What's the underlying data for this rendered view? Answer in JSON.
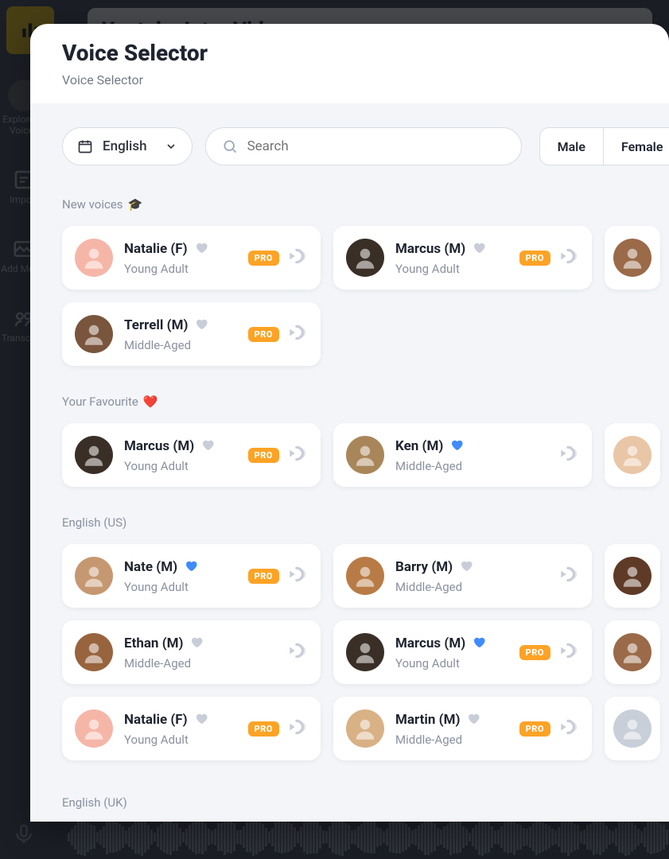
{
  "bg": {
    "project_title": "Youtube Intro Video",
    "sidebar": {
      "explore": "Explore AI Voices",
      "import": "Import",
      "media": "Add Media",
      "transcribe": "Transcribe"
    }
  },
  "modal": {
    "title": "Voice Selector",
    "subtitle": "Voice Selector",
    "language": "English",
    "search_placeholder": "Search",
    "segments": {
      "male": "Male",
      "female": "Female"
    },
    "pro_label": "PRO",
    "sections": [
      {
        "key": "new",
        "label": "New voices",
        "emoji": "🎓",
        "cards": [
          {
            "name": "Natalie (F)",
            "age": "Young Adult",
            "pro": true,
            "heart": "grey",
            "avatar": "#f5b6a8"
          },
          {
            "name": "Marcus (M)",
            "age": "Young Adult",
            "pro": true,
            "heart": "grey",
            "avatar": "#3a2f27"
          },
          {
            "name": "",
            "age": "",
            "pro": false,
            "heart": "",
            "avatar": "#9a6a49",
            "peek": true
          },
          {
            "name": "Terrell (M)",
            "age": "Middle-Aged",
            "pro": true,
            "heart": "grey",
            "avatar": "#7a553d"
          }
        ]
      },
      {
        "key": "fav",
        "label": "Your Favourite",
        "emoji": "❤️",
        "cards": [
          {
            "name": "Marcus (M)",
            "age": "Young Adult",
            "pro": true,
            "heart": "grey",
            "avatar": "#3a2f27"
          },
          {
            "name": "Ken (M)",
            "age": "Middle-Aged",
            "pro": false,
            "heart": "blue",
            "avatar": "#a98659"
          },
          {
            "name": "",
            "age": "",
            "pro": false,
            "heart": "",
            "avatar": "#e9c6a6",
            "peek": true
          }
        ]
      },
      {
        "key": "en_us",
        "label": "English (US)",
        "emoji": "",
        "cards": [
          {
            "name": "Nate (M)",
            "age": "Young Adult",
            "pro": true,
            "heart": "blue",
            "avatar": "#c69871"
          },
          {
            "name": "Barry (M)",
            "age": "Middle-Aged",
            "pro": false,
            "heart": "grey",
            "avatar": "#b97b46"
          },
          {
            "name": "",
            "age": "",
            "pro": false,
            "heart": "",
            "avatar": "#5e3a27",
            "peek": true
          },
          {
            "name": "Ethan (M)",
            "age": "Middle-Aged",
            "pro": false,
            "heart": "grey",
            "avatar": "#97643e"
          },
          {
            "name": "Marcus (M)",
            "age": "Young Adult",
            "pro": true,
            "heart": "blue",
            "avatar": "#3a2f27"
          },
          {
            "name": "",
            "age": "",
            "pro": false,
            "heart": "",
            "avatar": "#9a6a49",
            "peek": true
          },
          {
            "name": "Natalie (F)",
            "age": "Young Adult",
            "pro": true,
            "heart": "grey",
            "avatar": "#f5b6a8"
          },
          {
            "name": "Martin (M)",
            "age": "Middle-Aged",
            "pro": true,
            "heart": "grey",
            "avatar": "#d8b185"
          },
          {
            "name": "",
            "age": "",
            "pro": false,
            "heart": "",
            "avatar": "#c8cfd8",
            "peek": true
          }
        ]
      }
    ],
    "english_uk_label": "English (UK)"
  }
}
